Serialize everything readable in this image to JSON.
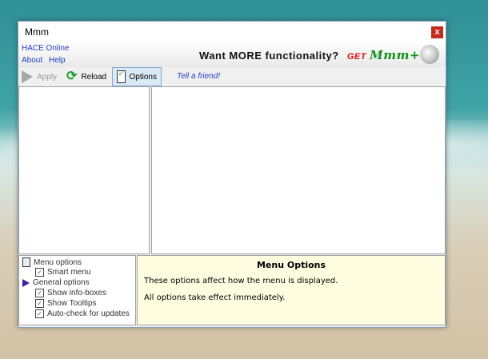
{
  "window": {
    "title": "Mmm",
    "close_glyph": "x"
  },
  "banner": {
    "links": [
      "HACE Online",
      "About",
      "Help"
    ],
    "promo_text": "Want MORE functionality?",
    "promo_get": "GET",
    "promo_logo": "Mmm+"
  },
  "toolbar": {
    "apply_label": "Apply",
    "reload_label": "Reload",
    "options_label": "Options",
    "tell_friend": "Tell a friend!"
  },
  "tree": {
    "items": [
      {
        "label": "Menu options",
        "icon": "menu-icon"
      },
      {
        "label": "Smart menu",
        "checked": true
      },
      {
        "label": "General options",
        "icon": "arrow-icon"
      },
      {
        "label": "Show info-boxes",
        "checked": true
      },
      {
        "label": "Show Tooltips",
        "checked": true
      },
      {
        "label": "Auto-check for updates",
        "checked": true
      }
    ]
  },
  "info": {
    "title": "Menu Options",
    "line1": "These options affect how the menu is displayed.",
    "line2": "All options take effect immediately."
  },
  "colors": {
    "link": "#1e3fc4",
    "info_bg": "#fffde0",
    "close": "#c42b1c"
  }
}
